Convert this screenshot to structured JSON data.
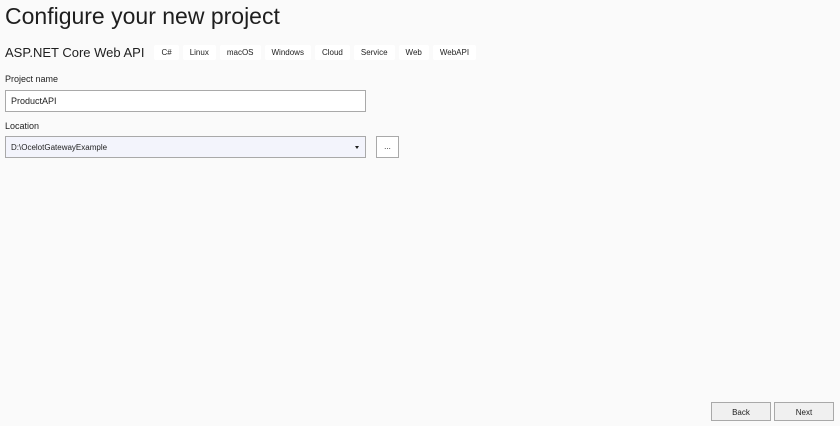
{
  "page": {
    "title": "Configure your new project"
  },
  "template": {
    "name": "ASP.NET Core Web API",
    "tags": [
      "C#",
      "Linux",
      "macOS",
      "Windows",
      "Cloud",
      "Service",
      "Web",
      "WebAPI"
    ]
  },
  "project_name": {
    "label": "Project name",
    "value": "ProductAPI"
  },
  "location": {
    "label": "Location",
    "value": "D:\\OcelotGatewayExample",
    "browse_label": "..."
  },
  "footer": {
    "back_label": "Back",
    "next_label": "Next"
  },
  "icons": {
    "dropdown": "chevron-down-icon"
  }
}
